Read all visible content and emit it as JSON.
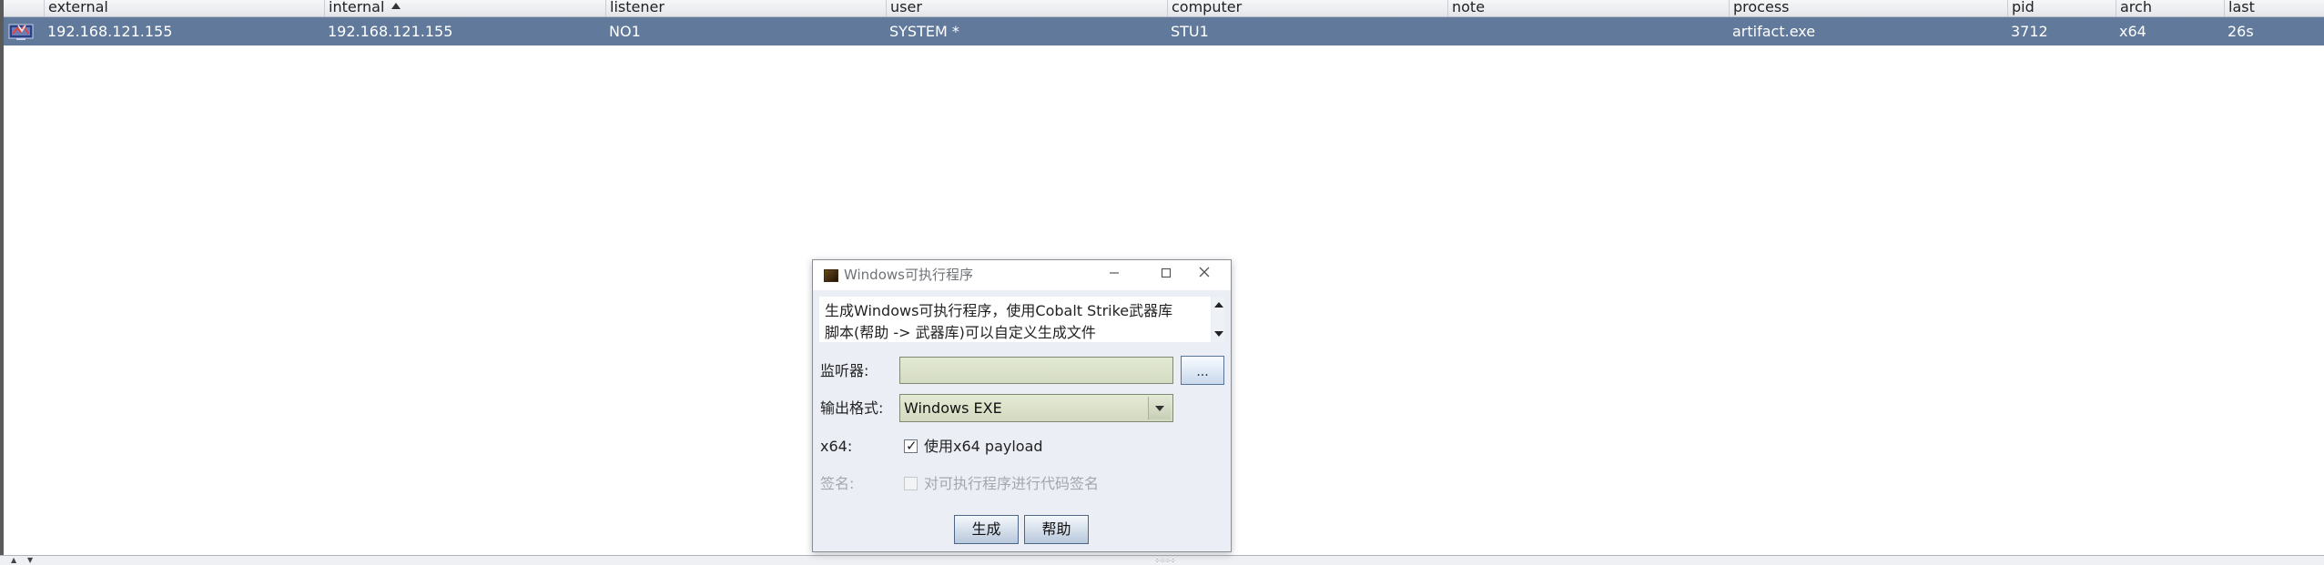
{
  "table": {
    "columns": [
      {
        "key": "external",
        "label": "external"
      },
      {
        "key": "internal",
        "label": "internal"
      },
      {
        "key": "listener",
        "label": "listener"
      },
      {
        "key": "user",
        "label": "user"
      },
      {
        "key": "computer",
        "label": "computer"
      },
      {
        "key": "note",
        "label": "note"
      },
      {
        "key": "process",
        "label": "process"
      },
      {
        "key": "pid",
        "label": "pid"
      },
      {
        "key": "arch",
        "label": "arch"
      },
      {
        "key": "last",
        "label": "last"
      }
    ],
    "sorted_column": "internal",
    "sort_direction": "ascending",
    "rows": [
      {
        "external": "192.168.121.155",
        "internal": "192.168.121.155",
        "listener": "NO1",
        "user": "SYSTEM *",
        "computer": "STU1",
        "note": "",
        "process": "artifact.exe",
        "pid": "3712",
        "arch": "x64",
        "last": "26s",
        "selected": true,
        "icon": "beacon-session-icon"
      }
    ],
    "selection_color": "#61799a"
  },
  "dialog": {
    "title": "Windows可执行程序",
    "description_line1": "生成Windows可执行程序，使用Cobalt Strike武器库",
    "description_line2": "脚本(帮助 -> 武器库)可以自定义生成文件",
    "listener_label": "监听器:",
    "listener_value": "",
    "browse_button": "...",
    "format_label": "输出格式:",
    "format_value": "Windows EXE",
    "x64_label": "x64:",
    "x64_checkbox_label": "使用x64 payload",
    "x64_checked": true,
    "sign_label": "签名:",
    "sign_checkbox_label": "对可执行程序进行代码签名",
    "sign_checked": false,
    "sign_enabled": false,
    "generate_button": "生成",
    "help_button": "帮助"
  }
}
